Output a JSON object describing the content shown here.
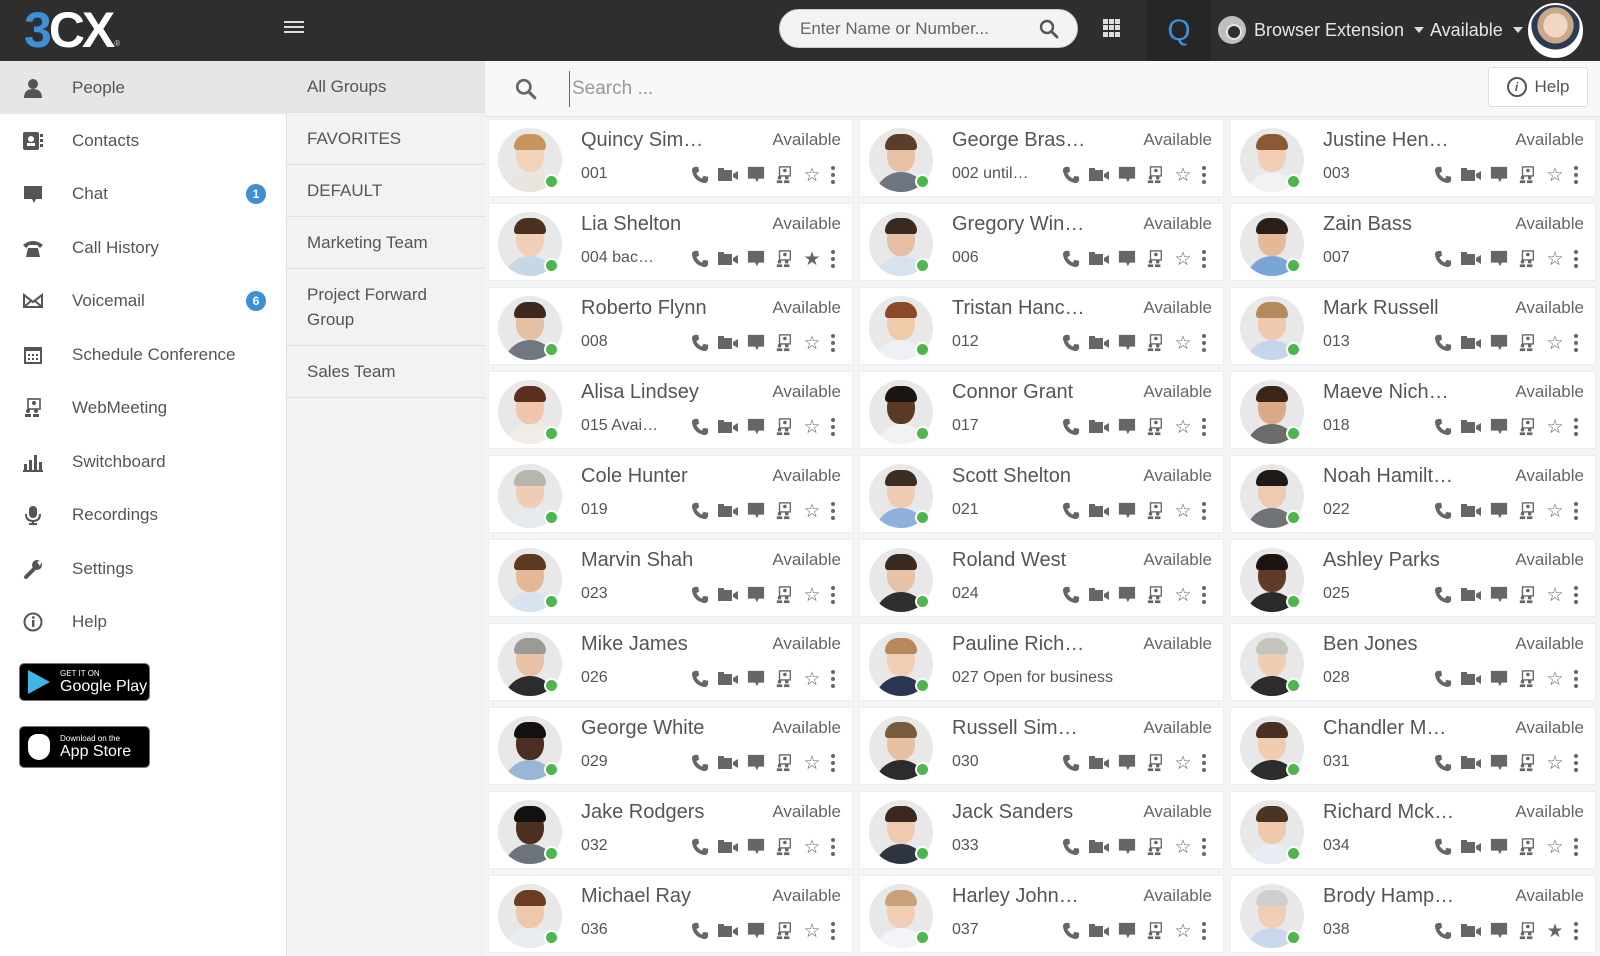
{
  "app": {
    "logo_main": "3",
    "logo_rest": "CX",
    "logo_reg": "®"
  },
  "topbar": {
    "dial_placeholder": "Enter Name or Number...",
    "q_label": "Q",
    "browser_extension_label": "Browser Extension",
    "status_label": "Available"
  },
  "sidebar": {
    "items": [
      {
        "label": "People",
        "icon": "person-icon",
        "active": true
      },
      {
        "label": "Contacts",
        "icon": "contacts-book-icon"
      },
      {
        "label": "Chat",
        "icon": "chat-bubble-icon",
        "badge": "1"
      },
      {
        "label": "Call History",
        "icon": "telephone-icon"
      },
      {
        "label": "Voicemail",
        "icon": "envelope-icon",
        "badge": "6"
      },
      {
        "label": "Schedule Conference",
        "icon": "calendar-icon"
      },
      {
        "label": "WebMeeting",
        "icon": "webmeeting-icon"
      },
      {
        "label": "Switchboard",
        "icon": "bar-chart-icon"
      },
      {
        "label": "Recordings",
        "icon": "microphone-icon"
      },
      {
        "label": "Settings",
        "icon": "wrench-icon"
      },
      {
        "label": "Help",
        "icon": "info-icon"
      }
    ],
    "google_play": {
      "small": "GET IT ON",
      "big": "Google Play"
    },
    "app_store": {
      "small": "Download on the",
      "big": "App Store"
    }
  },
  "groups": {
    "items": [
      {
        "label": "All Groups",
        "active": true
      },
      {
        "label": "FAVORITES"
      },
      {
        "label": "DEFAULT"
      },
      {
        "label": "Marketing Team"
      },
      {
        "label": "Project Forward Group"
      },
      {
        "label": "Sales Team"
      }
    ]
  },
  "main": {
    "search_placeholder": "Search ...",
    "help_label": "Help",
    "accent_color": "#3d8fd6",
    "presence_color": "#4cb54c",
    "contacts": [
      {
        "name": "Quincy Sim…",
        "ext": "001",
        "note": "",
        "status": "Available",
        "favorite": false,
        "actions": true,
        "skin": "#f3d2bb",
        "hair": "#c8965c",
        "cloth": "#e9e4dd"
      },
      {
        "name": "George Bras…",
        "ext": "002",
        "note": "until…",
        "status": "Available",
        "favorite": false,
        "actions": true,
        "skin": "#e8c1a4",
        "hair": "#5a3d2a",
        "cloth": "#6d7580"
      },
      {
        "name": "Justine Hen…",
        "ext": "003",
        "note": "",
        "status": "Available",
        "favorite": false,
        "actions": true,
        "skin": "#f1cdb5",
        "hair": "#8a5a36",
        "cloth": "#f2f2f2"
      },
      {
        "name": "Lia Shelton",
        "ext": "004",
        "note": "bac…",
        "status": "Available",
        "favorite": true,
        "actions": true,
        "skin": "#f1cfb6",
        "hair": "#4a3020",
        "cloth": "#c8d7e6"
      },
      {
        "name": "Gregory Win…",
        "ext": "006",
        "note": "",
        "status": "Available",
        "favorite": false,
        "actions": true,
        "skin": "#e6bfa2",
        "hair": "#3b2a20",
        "cloth": "#d8e2ee"
      },
      {
        "name": "Zain Bass",
        "ext": "007",
        "note": "",
        "status": "Available",
        "favorite": false,
        "actions": true,
        "skin": "#e3b998",
        "hair": "#2d1f17",
        "cloth": "#7aa6d6"
      },
      {
        "name": "Roberto Flynn",
        "ext": "008",
        "note": "",
        "status": "Available",
        "favorite": false,
        "actions": true,
        "skin": "#e6c0a3",
        "hair": "#3d2a1e",
        "cloth": "#70777f"
      },
      {
        "name": "Tristan Hanc…",
        "ext": "012",
        "note": "",
        "status": "Available",
        "favorite": false,
        "actions": true,
        "skin": "#f0caa9",
        "hair": "#8a4a28",
        "cloth": "#eef0f4"
      },
      {
        "name": "Mark Russell",
        "ext": "013",
        "note": "",
        "status": "Available",
        "favorite": false,
        "actions": true,
        "skin": "#efc9ad",
        "hair": "#b58a5c",
        "cloth": "#c4d6ec"
      },
      {
        "name": "Alisa Lindsey",
        "ext": "015",
        "note": "Avai…",
        "status": "Available",
        "favorite": false,
        "actions": true,
        "skin": "#efc6ab",
        "hair": "#5b2f1d",
        "cloth": "#f0ece8"
      },
      {
        "name": "Connor Grant",
        "ext": "017",
        "note": "",
        "status": "Available",
        "favorite": false,
        "actions": true,
        "skin": "#5b3a25",
        "hair": "#1c1410",
        "cloth": "#f2f2f2"
      },
      {
        "name": "Maeve Nich…",
        "ext": "018",
        "note": "",
        "status": "Available",
        "favorite": false,
        "actions": true,
        "skin": "#d9a988",
        "hair": "#3a2518",
        "cloth": "#6b6b6b"
      },
      {
        "name": "Cole Hunter",
        "ext": "019",
        "note": "",
        "status": "Available",
        "favorite": false,
        "actions": true,
        "skin": "#efcdb5",
        "hair": "#b8b4ae",
        "cloth": "#e6e9ee"
      },
      {
        "name": "Scott Shelton",
        "ext": "021",
        "note": "",
        "status": "Available",
        "favorite": false,
        "actions": true,
        "skin": "#efcdb4",
        "hair": "#3a2d24",
        "cloth": "#8fb0d9"
      },
      {
        "name": "Noah Hamilt…",
        "ext": "022",
        "note": "",
        "status": "Available",
        "favorite": false,
        "actions": true,
        "skin": "#efcab1",
        "hair": "#1f1a17",
        "cloth": "#6f7378"
      },
      {
        "name": "Marvin Shah",
        "ext": "023",
        "note": "",
        "status": "Available",
        "favorite": false,
        "actions": true,
        "skin": "#e3b897",
        "hair": "#5b3a22",
        "cloth": "#d8e3f0"
      },
      {
        "name": "Roland West",
        "ext": "024",
        "note": "",
        "status": "Available",
        "favorite": false,
        "actions": true,
        "skin": "#e8c2a4",
        "hair": "#3a2a20",
        "cloth": "#2f2f2f"
      },
      {
        "name": "Ashley Parks",
        "ext": "025",
        "note": "",
        "status": "Available",
        "favorite": false,
        "actions": true,
        "skin": "#5e3c27",
        "hair": "#1c1410",
        "cloth": "#2a2a2a"
      },
      {
        "name": "Mike James",
        "ext": "026",
        "note": "",
        "status": "Available",
        "favorite": false,
        "actions": true,
        "skin": "#e9c2a5",
        "hair": "#9a9a96",
        "cloth": "#2c2c2c"
      },
      {
        "name": "Pauline Rich…",
        "ext": "027",
        "note": "Open for business",
        "status": "Available",
        "favorite": false,
        "actions": false,
        "skin": "#f0cdb3",
        "hair": "#b8875a",
        "cloth": "#2a3650"
      },
      {
        "name": "Ben Jones",
        "ext": "028",
        "note": "",
        "status": "Available",
        "favorite": false,
        "actions": true,
        "skin": "#efcdb3",
        "hair": "#c4c4c0",
        "cloth": "#2c2c2c"
      },
      {
        "name": "George White",
        "ext": "029",
        "note": "",
        "status": "Available",
        "favorite": false,
        "actions": true,
        "skin": "#4a2f20",
        "hair": "#141010",
        "cloth": "#9ab5d6"
      },
      {
        "name": "Russell Sim…",
        "ext": "030",
        "note": "",
        "status": "Available",
        "favorite": false,
        "actions": true,
        "skin": "#e6c0a1",
        "hair": "#7a5a3d",
        "cloth": "#2c2c2c"
      },
      {
        "name": "Chandler M…",
        "ext": "031",
        "note": "",
        "status": "Available",
        "favorite": false,
        "actions": true,
        "skin": "#f0cbb0",
        "hair": "#4a3222",
        "cloth": "#2c2c2c"
      },
      {
        "name": "Jake Rodgers",
        "ext": "032",
        "note": "",
        "status": "Available",
        "favorite": false,
        "actions": true,
        "skin": "#4d2f1f",
        "hair": "#151010",
        "cloth": "#6d737b"
      },
      {
        "name": "Jack Sanders",
        "ext": "033",
        "note": "",
        "status": "Available",
        "favorite": false,
        "actions": true,
        "skin": "#efcab0",
        "hair": "#3a2820",
        "cloth": "#2f3540"
      },
      {
        "name": "Richard Mck…",
        "ext": "034",
        "note": "",
        "status": "Available",
        "favorite": false,
        "actions": true,
        "skin": "#f0c9ac",
        "hair": "#4a3424",
        "cloth": "#e8edf3"
      },
      {
        "name": "Michael Ray",
        "ext": "036",
        "note": "",
        "status": "Available",
        "favorite": false,
        "actions": true,
        "skin": "#efc8ac",
        "hair": "#6a3d22",
        "cloth": "#e9edf2"
      },
      {
        "name": "Harley John…",
        "ext": "037",
        "note": "",
        "status": "Available",
        "favorite": false,
        "actions": true,
        "skin": "#f1cdb3",
        "hair": "#c9a07a",
        "cloth": "#f2f4f7"
      },
      {
        "name": "Brody Hamp…",
        "ext": "038",
        "note": "",
        "status": "Available",
        "favorite": true,
        "actions": true,
        "skin": "#efcdb6",
        "hair": "#cfcfcb",
        "cloth": "#c8d8ea"
      }
    ]
  }
}
